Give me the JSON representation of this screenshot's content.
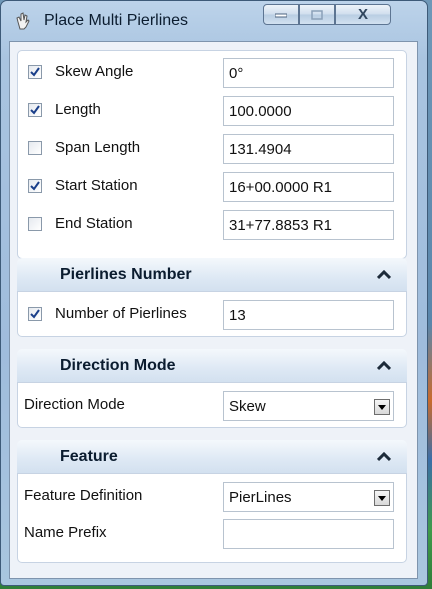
{
  "window": {
    "title": "Place Multi Pierlines",
    "minimize_icon": "minimize-icon",
    "maximize_icon": "maximize-icon",
    "close_icon": "close-icon",
    "close_glyph": "X"
  },
  "main": {
    "rows": [
      {
        "label": "Skew Angle",
        "checked": true,
        "value": "0°"
      },
      {
        "label": "Length",
        "checked": true,
        "value": "100.0000"
      },
      {
        "label": "Span Length",
        "checked": false,
        "value": "131.4904"
      },
      {
        "label": "Start Station",
        "checked": true,
        "value": "16+00.0000 R1"
      },
      {
        "label": "End Station",
        "checked": false,
        "value": "31+77.8853 R1"
      }
    ]
  },
  "pierlines_number": {
    "header": "Pierlines Number",
    "row": {
      "label": "Number of Pierlines",
      "checked": true,
      "value": "13"
    }
  },
  "direction_mode": {
    "header": "Direction Mode",
    "row": {
      "label": "Direction Mode",
      "value": "Skew"
    }
  },
  "feature": {
    "header": "Feature",
    "definition": {
      "label": "Feature Definition",
      "value": "PierLines"
    },
    "name_prefix": {
      "label": "Name Prefix",
      "value": ""
    }
  }
}
